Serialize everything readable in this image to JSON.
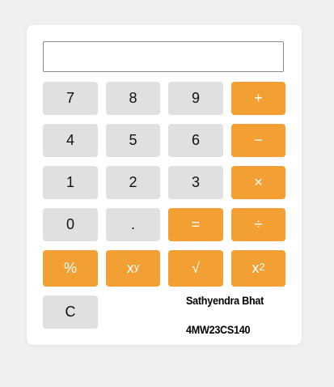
{
  "calculator": {
    "display_value": "",
    "buttons": {
      "seven": "7",
      "eight": "8",
      "nine": "9",
      "plus": "+",
      "four": "4",
      "five": "5",
      "six": "6",
      "minus": "−",
      "one": "1",
      "two": "2",
      "three": "3",
      "multiply": "×",
      "zero": "0",
      "decimal": ".",
      "equals": "=",
      "divide": "÷",
      "percent": "%",
      "power_base": "x",
      "power_exp": "y",
      "sqrt": "√",
      "square_base": "x",
      "square_exp": "2",
      "clear": "C"
    }
  },
  "author": {
    "name": "Sathyendra Bhat",
    "usn": "4MW23CS140"
  },
  "colors": {
    "page_background": "#efefef",
    "card_background": "#ffffff",
    "number_button": "#e0e0e0",
    "operator_button": "#f2a033",
    "operator_text": "#ffffff"
  }
}
